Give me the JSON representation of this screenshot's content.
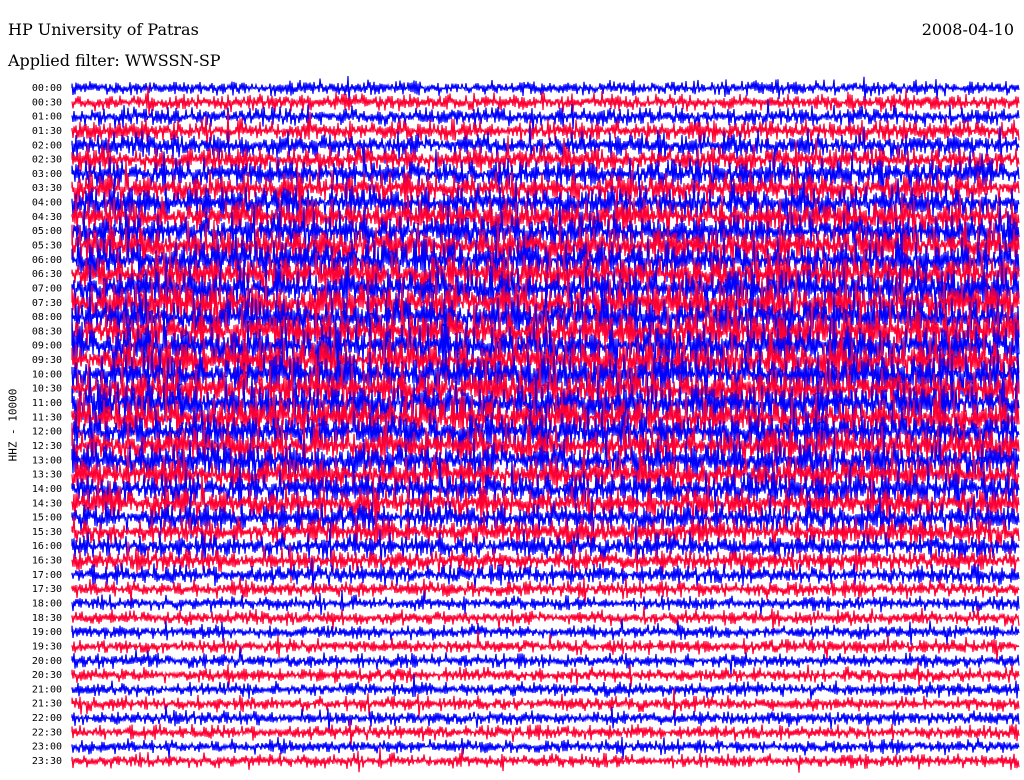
{
  "header": {
    "station": "HP University of Patras",
    "date": "2008-04-10",
    "filter": "Applied filter: WWSSN-SP"
  },
  "chart_data": {
    "type": "line",
    "title": "HP University of Patras",
    "channel_label": "HHZ - 10000",
    "rows": [
      "00:00",
      "00:30",
      "01:00",
      "01:30",
      "02:00",
      "02:30",
      "03:00",
      "03:30",
      "04:00",
      "04:30",
      "05:00",
      "05:30",
      "06:00",
      "06:30",
      "07:00",
      "07:30",
      "08:00",
      "08:30",
      "09:00",
      "09:30",
      "10:00",
      "10:30",
      "11:00",
      "11:30",
      "12:00",
      "12:30",
      "13:00",
      "13:30",
      "14:00",
      "14:30",
      "15:00",
      "15:30",
      "16:00",
      "16:30",
      "17:00",
      "17:30",
      "18:00",
      "18:30",
      "19:00",
      "19:30",
      "20:00",
      "20:30",
      "21:00",
      "21:30",
      "22:00",
      "22:30",
      "23:00",
      "23:30"
    ],
    "series_colors": [
      "#0000ff",
      "#ff0033"
    ],
    "background": "#ffffff",
    "grid": false
  }
}
